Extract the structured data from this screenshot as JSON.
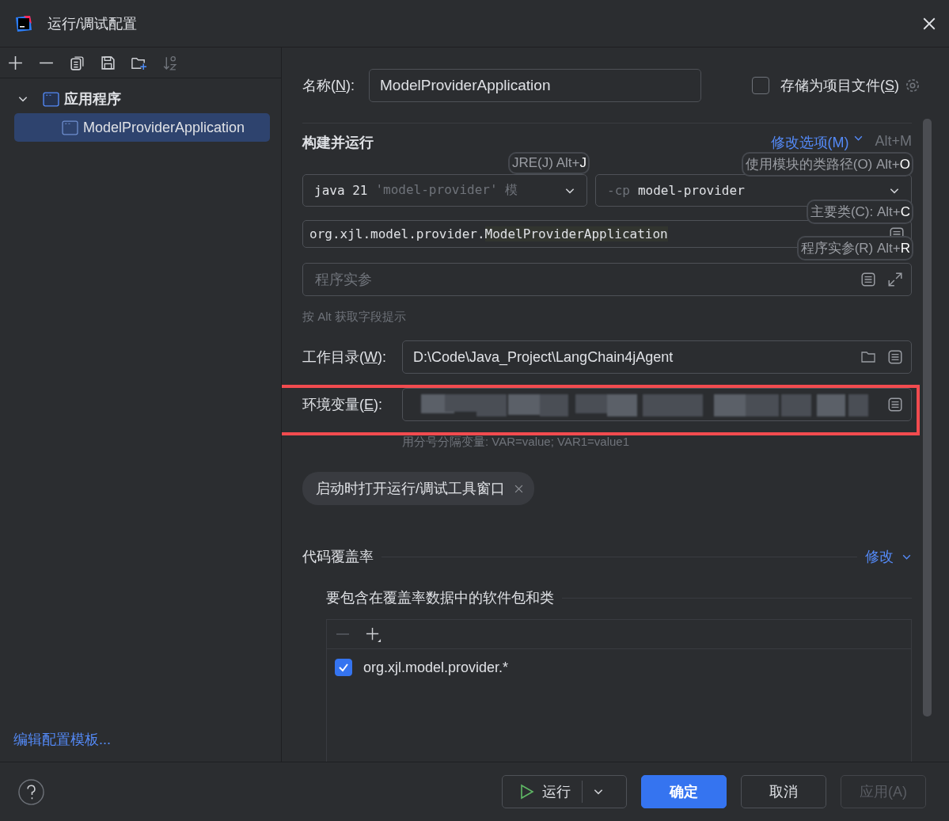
{
  "window": {
    "title": "运行/调试配置"
  },
  "tree": [
    {
      "label": "应用程序",
      "expanded": true,
      "children": [
        {
          "label": "ModelProviderApplication",
          "selected": true
        }
      ]
    }
  ],
  "edit_templates_link": "编辑配置模板...",
  "name_field": {
    "label": {
      "prefix": "名称(",
      "mnemonic": "N",
      "suffix": "):"
    },
    "value": "ModelProviderApplication"
  },
  "store_as_file": {
    "label": {
      "prefix": "存储为项目文件(",
      "mnemonic": "S",
      "suffix": ")"
    },
    "checked": false
  },
  "build_run": {
    "title": "构建并运行",
    "modify_options": "修改选项(M)",
    "modify_shortcut": "Alt+M",
    "jre": {
      "value": "java 21",
      "hint": "'model-provider' 模"
    },
    "classpath": {
      "flag": "-cp",
      "value": "model-provider"
    },
    "main_class": {
      "package": "org.xjl.model.provider.",
      "name": "ModelProviderApplication"
    },
    "program_args": {
      "placeholder": "程序实参"
    },
    "field_hints": [
      {
        "text": "JRE(J) Alt+",
        "key": "J"
      },
      {
        "text": "使用模块的类路径(O) Alt+",
        "key": "O"
      },
      {
        "text": "主要类(C): Alt+",
        "key": "C"
      },
      {
        "text": "程序实参(R) Alt+",
        "key": "R"
      }
    ]
  },
  "alt_tip": "按 Alt 获取字段提示",
  "working_dir": {
    "label": {
      "prefix": "工作目录(",
      "mnemonic": "W",
      "suffix": "):"
    },
    "value": "D:\\Code\\Java_Project\\LangChain4jAgent"
  },
  "env_vars": {
    "label": {
      "prefix": "环境变量(",
      "mnemonic": "E",
      "suffix": "):"
    },
    "hint": "用分号分隔变量: VAR=value; VAR1=value1",
    "highlighted": true
  },
  "tags": [
    {
      "label": "启动时打开运行/调试工具窗口"
    }
  ],
  "coverage": {
    "title": "代码覆盖率",
    "modify": "修改",
    "include_title": "要包含在覆盖率数据中的软件包和类",
    "patterns": [
      {
        "label": "org.xjl.model.provider.*",
        "checked": true
      }
    ]
  },
  "buttons": [
    {
      "label": "运行",
      "kind": "split"
    },
    {
      "label": "确定",
      "kind": "primary"
    },
    {
      "label": "取消",
      "kind": "normal"
    },
    {
      "label": "应用(A)",
      "kind": "disabled"
    }
  ]
}
